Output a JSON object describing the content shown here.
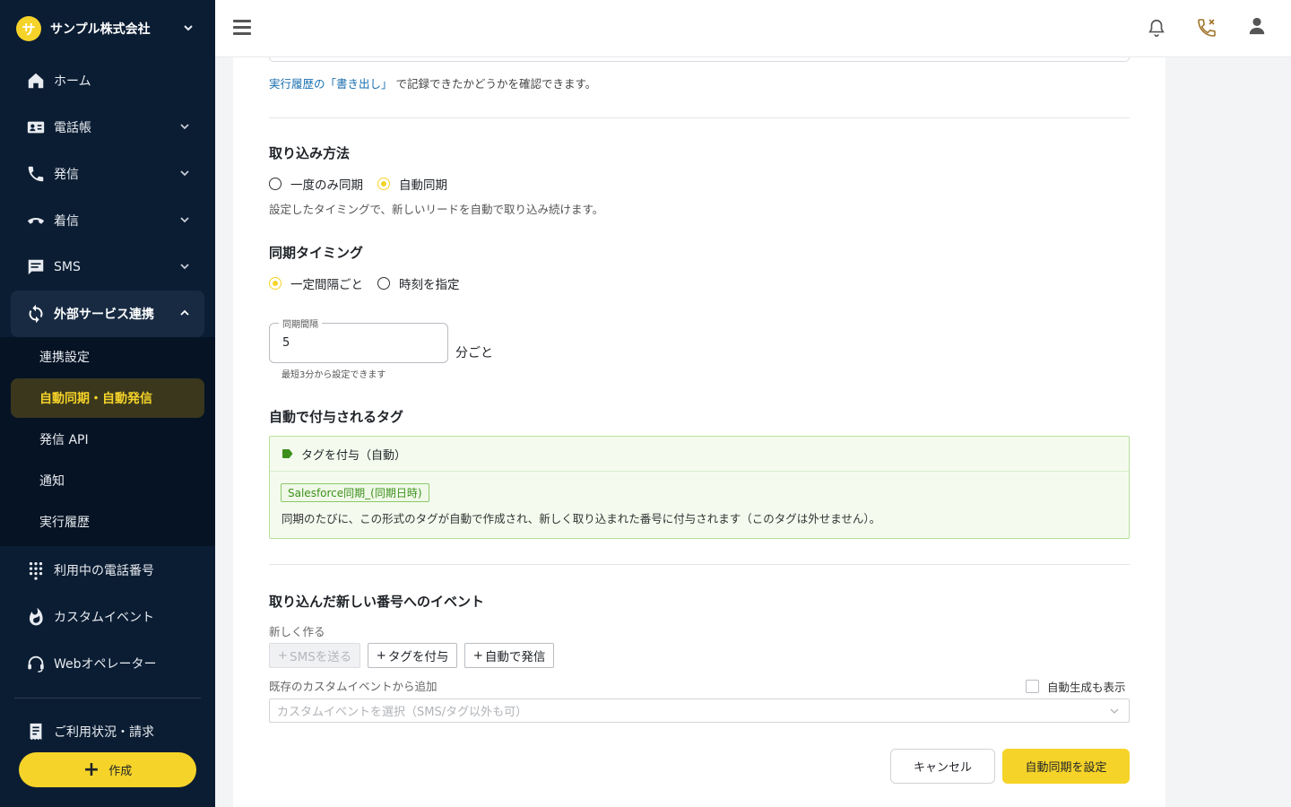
{
  "org": {
    "logo_char": "サ",
    "name": "サンプル株式会社"
  },
  "sidebar": {
    "items": [
      {
        "label": "ホーム",
        "icon": "home-icon"
      },
      {
        "label": "電話帳",
        "icon": "contacts-icon"
      },
      {
        "label": "発信",
        "icon": "phone-outgoing-icon"
      },
      {
        "label": "着信",
        "icon": "phone-incoming-icon"
      },
      {
        "label": "SMS",
        "icon": "sms-icon"
      },
      {
        "label": "外部サービス連携",
        "icon": "sync-icon"
      },
      {
        "label": "利用中の電話番号",
        "icon": "dialpad-icon"
      },
      {
        "label": "カスタムイベント",
        "icon": "flame-icon"
      },
      {
        "label": "Webオペレーター",
        "icon": "headset-icon"
      },
      {
        "label": "ご利用状況・請求",
        "icon": "receipt-icon"
      }
    ],
    "sub_items": [
      {
        "label": "連携設定"
      },
      {
        "label": "自動同期・自動発信"
      },
      {
        "label": "発信 API"
      },
      {
        "label": "通知"
      },
      {
        "label": "実行履歴"
      }
    ],
    "create_label": "作成"
  },
  "header": {
    "icons": [
      "menu-icon",
      "bell-icon",
      "phone-missed-icon",
      "user-icon"
    ]
  },
  "main": {
    "hint_link": "実行履歴の「書き出し」",
    "hint_rest": " で記録できたかどうかを確認できます。",
    "import_method": {
      "title": "取り込み方法",
      "options": [
        "一度のみ同期",
        "自動同期"
      ],
      "selected": "自動同期",
      "description": "設定したタイミングで、新しいリードを自動で取り込み続けます。"
    },
    "sync_timing": {
      "title": "同期タイミング",
      "options": [
        "一定間隔ごと",
        "時刻を指定"
      ],
      "selected": "一定間隔ごと",
      "interval_label": "同期間隔",
      "interval_value": "5",
      "interval_suffix": "分ごと",
      "interval_help": "最短3分から設定できます"
    },
    "auto_tags": {
      "title": "自動で付与されるタグ",
      "header": "タグを付与（自動）",
      "chip": "Salesforce同期_(同期日時)",
      "description": "同期のたびに、この形式のタグが自動で作成され、新しく取り込まれた番号に付与されます（このタグは外せません）。"
    },
    "events": {
      "title": "取り込んだ新しい番号へのイベント",
      "new_label": "新しく作る",
      "buttons": [
        "SMSを送る",
        "タグを付与",
        "自動で発信"
      ],
      "existing_label": "既存のカスタムイベントから追加",
      "checkbox_label": "自動生成も表示",
      "select_placeholder": "カスタムイベントを選択（SMS/タグ以外も可）"
    },
    "actions": {
      "cancel": "キャンセル",
      "submit": "自動同期を設定"
    }
  },
  "colors": {
    "sidebar_bg": "#0b1d33",
    "accent": "#f5d329",
    "link": "#1a6fb0",
    "tag_green": "#3d8f1d"
  }
}
